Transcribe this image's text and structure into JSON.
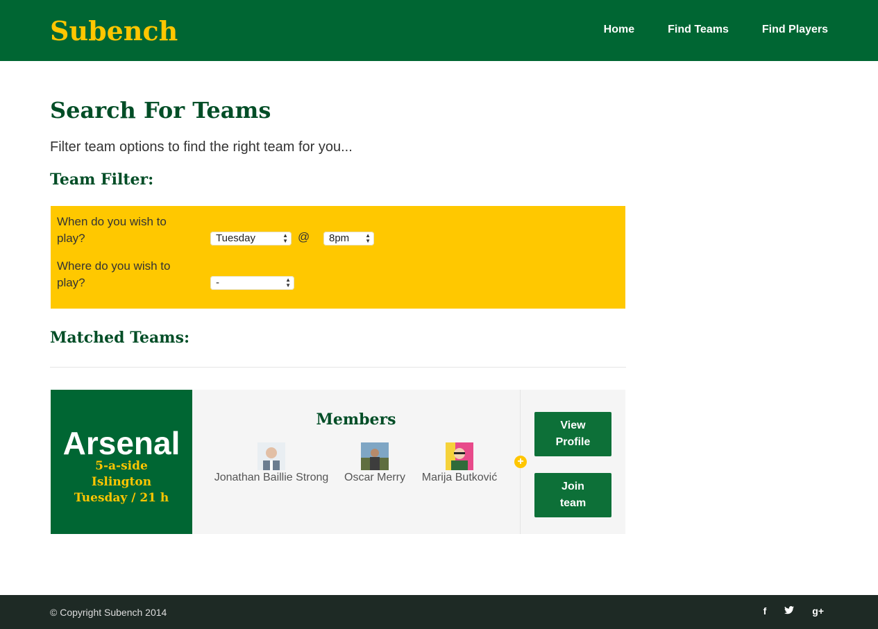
{
  "header": {
    "logo": "Subench",
    "nav": [
      "Home",
      "Find Teams",
      "Find Players"
    ]
  },
  "main": {
    "title": "Search For Teams",
    "subtitle": "Filter team options to find the right team for you...",
    "filter_heading": "Team Filter:",
    "filter": {
      "when_label": "When do you wish to play?",
      "day_value": "Tuesday",
      "at_symbol": "@",
      "time_value": "8pm",
      "where_label": "Where do you wish to play?",
      "location_value": "-"
    },
    "matched_heading": "Matched Teams:"
  },
  "team_card": {
    "name": "Arsenal",
    "format": "5-a-side",
    "location": "Islington",
    "schedule": "Tuesday / 21 h",
    "members_heading": "Members",
    "members": [
      {
        "name": "Jonathan Baillie Strong"
      },
      {
        "name": "Oscar Merry"
      },
      {
        "name": "Marija Butković"
      }
    ],
    "view_profile_label": "View Profile",
    "join_team_label": "Join team"
  },
  "footer": {
    "copyright": "© Copyright Subench 2014",
    "social_icons": [
      "facebook-icon",
      "twitter-icon",
      "google-plus-icon"
    ]
  },
  "colors": {
    "brand_green": "#006633",
    "brand_yellow": "#ffc600",
    "footer_bg": "#1e2a25"
  }
}
